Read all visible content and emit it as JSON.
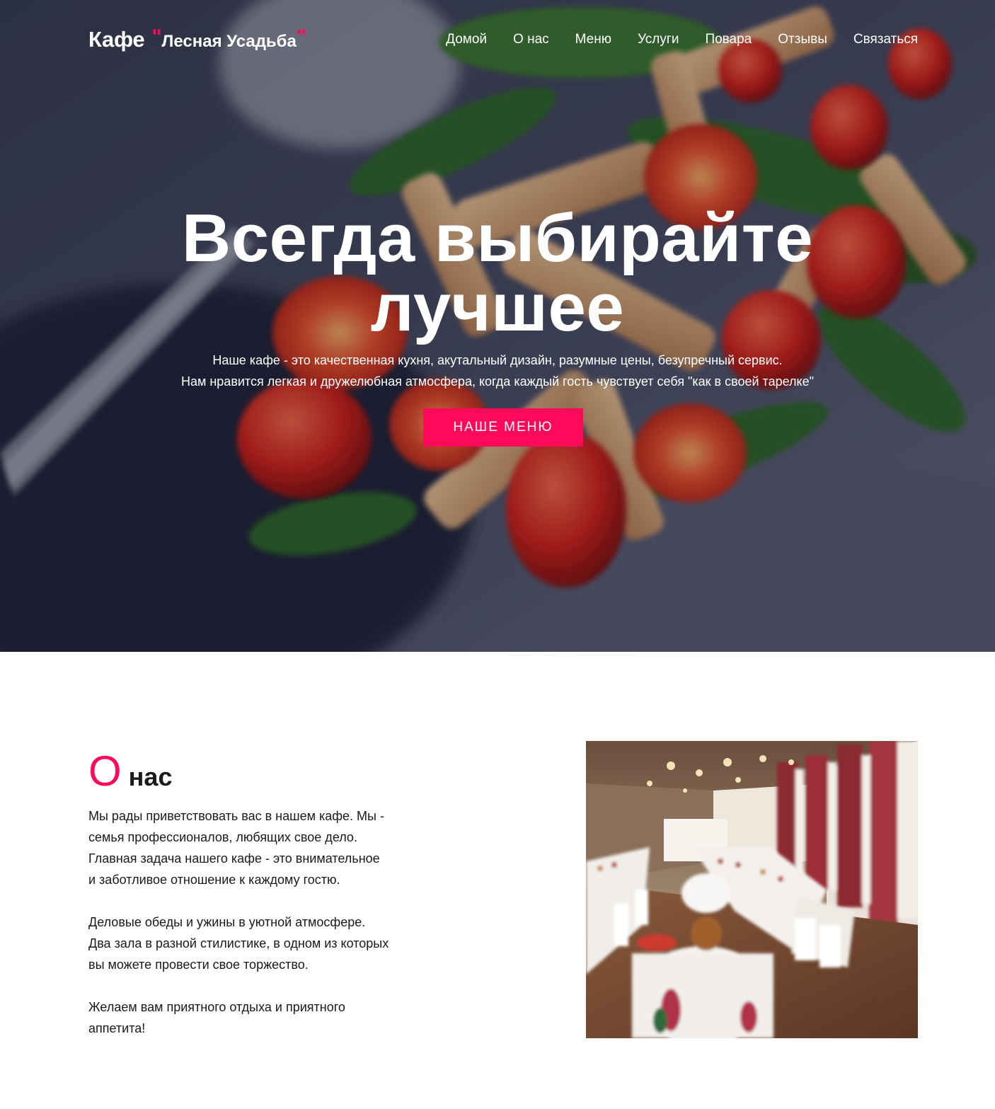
{
  "colors": {
    "accent": "#ff0a5a",
    "text": "#1a1a1a",
    "hero_text": "#ffffff",
    "page_bg": "#ffffff"
  },
  "header": {
    "brand_main": "Кафе",
    "brand_quote_open": "\"",
    "brand_name": "Лесная Усадьба",
    "brand_quote_close": "\"",
    "nav": [
      {
        "label": "Домой"
      },
      {
        "label": "О нас"
      },
      {
        "label": "Меню"
      },
      {
        "label": "Услуги"
      },
      {
        "label": "Повара"
      },
      {
        "label": "Отзывы"
      },
      {
        "label": "Связаться"
      }
    ]
  },
  "hero": {
    "title_lines": [
      "Всегда выбирайте",
      "лучшее"
    ],
    "text_lines": [
      "Наше кафе - это качественная кухня, акутальный дизайн, разумные цены, безупречный сервис.",
      "Нам нравится легкая и дружелюбная атмосфера, когда каждый гость чувствует себя \"как в своей тарелке\""
    ],
    "button_label": "Наше меню"
  },
  "about": {
    "title_letter": "О",
    "title_rest": "нас",
    "paragraphs": [
      [
        "Мы рады приветствовать вас в нашем кафе. Мы -",
        "семья профессионалов, любящих свое дело.",
        "Главная задача нашего кафе - это внимательное",
        "и заботливое отношение к каждому гостю."
      ],
      [
        "Деловые обеды и ужины в уютной атмосфере.",
        "Два зала в разной стилистике, в одном из которых",
        "вы можете провести свое торжество."
      ],
      [
        "Желаем вам приятного отдыха и приятного",
        "аппетита!"
      ]
    ]
  }
}
